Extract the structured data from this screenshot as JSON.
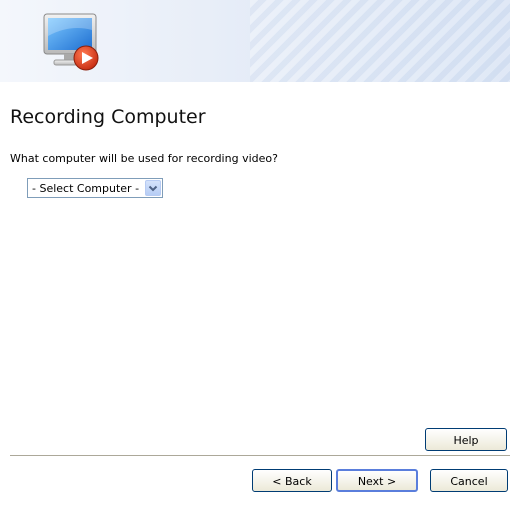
{
  "banner": {
    "icon": "monitor-record-icon"
  },
  "page": {
    "title": "Recording Computer",
    "prompt": "What computer will be used for recording video?"
  },
  "computer_select": {
    "value": "- Select Computer -",
    "icon": "chevron-down-icon"
  },
  "buttons": {
    "help": "Help",
    "back": "< Back",
    "next": "Next >",
    "cancel": "Cancel"
  },
  "colors": {
    "accent": "#5a7edc",
    "record_red": "#d9391b",
    "screen_blue": "#2f8fe0"
  }
}
